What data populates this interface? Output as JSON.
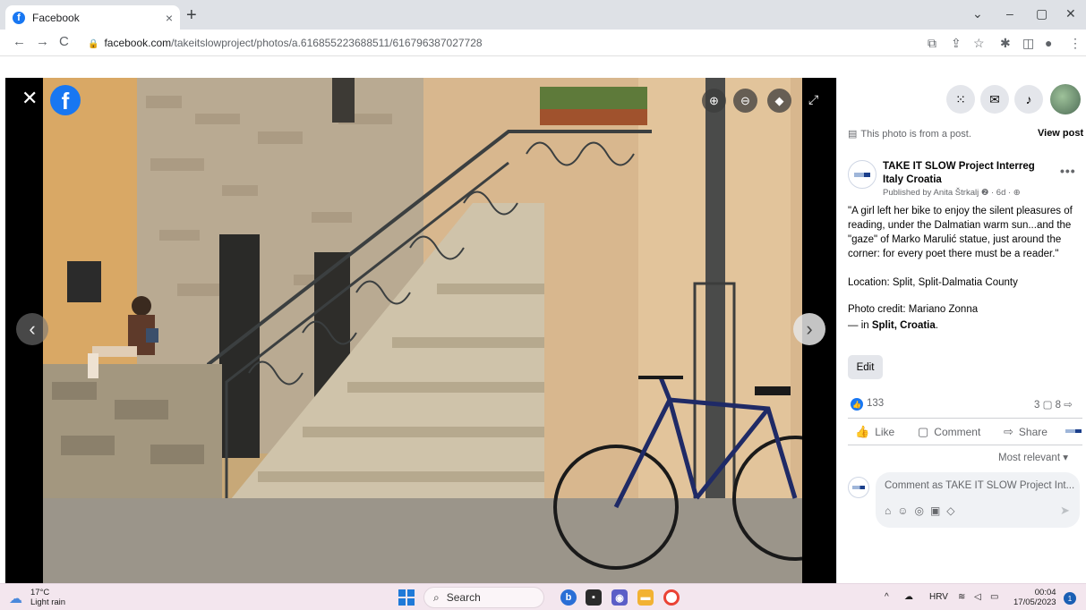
{
  "browser": {
    "tab_title": "Facebook",
    "tab_close": "×",
    "new_tab": "+",
    "url_domain": "facebook.com",
    "url_path": "/takeitslowproject/photos/a.616855223688511/616796387027728",
    "window_controls": [
      "⌄",
      "–",
      "▢",
      "✕"
    ]
  },
  "viewer": {
    "close_icon": "✕",
    "logo_letter": "f",
    "prev_arrow": "‹",
    "next_arrow": "›",
    "tools": [
      "zoom-in-icon",
      "zoom-out-icon",
      "tag-icon",
      "fullscreen-icon"
    ]
  },
  "panel": {
    "from_post_text": "This photo is from a post.",
    "view_post": "View post",
    "page_name": "TAKE IT SLOW Project Interreg Italy Croatia",
    "published": "Published by Anita Štrkalj ❷ · 6d · ⊕",
    "caption_quote": "\"A girl left her bike to enjoy the silent pleasures of reading, under the Dalmatian warm sun...and the \"gaze\" of Marko Marulić statue, just around the corner: for every poet there must be a reader.\"",
    "location": "Location: Split, Split-Dalmatia County",
    "photo_credit": "Photo credit: Mariano Zonna",
    "in_prefix": "— in ",
    "in_place": "Split, Croatia",
    "in_suffix": ".",
    "edit_label": "Edit",
    "reaction_count": "133",
    "comment_share_counts": "3 ▢  8 ⇨",
    "like_label": "Like",
    "comment_label": "Comment",
    "share_label": "Share",
    "most_relevant": "Most relevant ▾",
    "comment_placeholder": "Comment as TAKE IT SLOW Project Int..."
  },
  "taskbar": {
    "temp": "17°C",
    "weather": "Light rain",
    "search_label": "Search",
    "language": "HRV",
    "time": "00:04",
    "date": "17/05/2023",
    "notification_count": "1"
  },
  "colors": {
    "facebook_blue": "#1877f2",
    "panel_bg": "#ffffff",
    "taskbar_bg": "#f3e6ee"
  }
}
